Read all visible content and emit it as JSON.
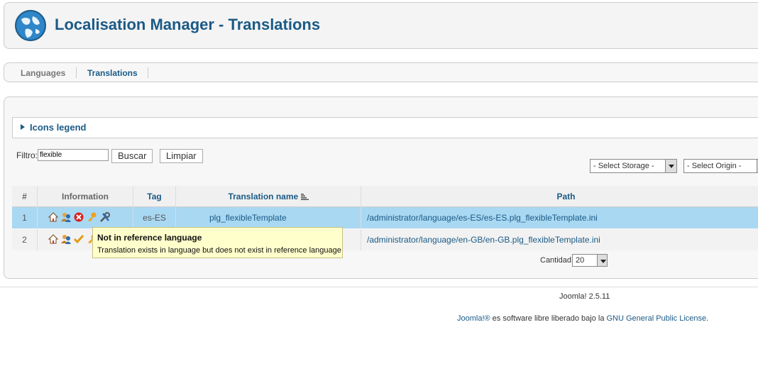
{
  "header": {
    "title": "Localisation Manager - Translations",
    "icon": "globe-icon"
  },
  "tabs": [
    {
      "label": "Languages",
      "active": false
    },
    {
      "label": "Translations",
      "active": true
    }
  ],
  "legend": {
    "title": "Icons legend"
  },
  "filter": {
    "label": "Filtro:",
    "value": "flexible",
    "search_button": "Buscar",
    "clear_button": "Limpiar",
    "storage_select": "- Select Storage -",
    "origin_select": "- Select Origin -"
  },
  "table": {
    "columns": {
      "num": "#",
      "information": "Information",
      "tag": "Tag",
      "name": "Translation name",
      "path": "Path"
    },
    "rows": [
      {
        "num": "1",
        "icons": [
          "home-icon",
          "users-icon",
          "error-icon",
          "key-icon",
          "tools-icon"
        ],
        "tag": "es-ES",
        "name": "plg_flexibleTemplate",
        "path": "/administrator/language/es-ES/es-ES.plg_flexibleTemplate.ini"
      },
      {
        "num": "2",
        "icons": [
          "home-icon",
          "users-icon",
          "checkmark-icon",
          "key-icon"
        ],
        "tag": "",
        "name": "",
        "path": "/administrator/language/en-GB/en-GB.plg_flexibleTemplate.ini"
      }
    ],
    "quantity_label": "Cantidad",
    "quantity_value": "20"
  },
  "tooltip": {
    "title": "Not in reference language",
    "text": "Translation exists in language but does not exist in reference language"
  },
  "footer": {
    "version": "Joomla! 2.5.11",
    "license_pre": "Joomla!®",
    "license_mid": " es software libre liberado bajo la ",
    "license_link": "GNU General Public License",
    "license_post": "."
  }
}
